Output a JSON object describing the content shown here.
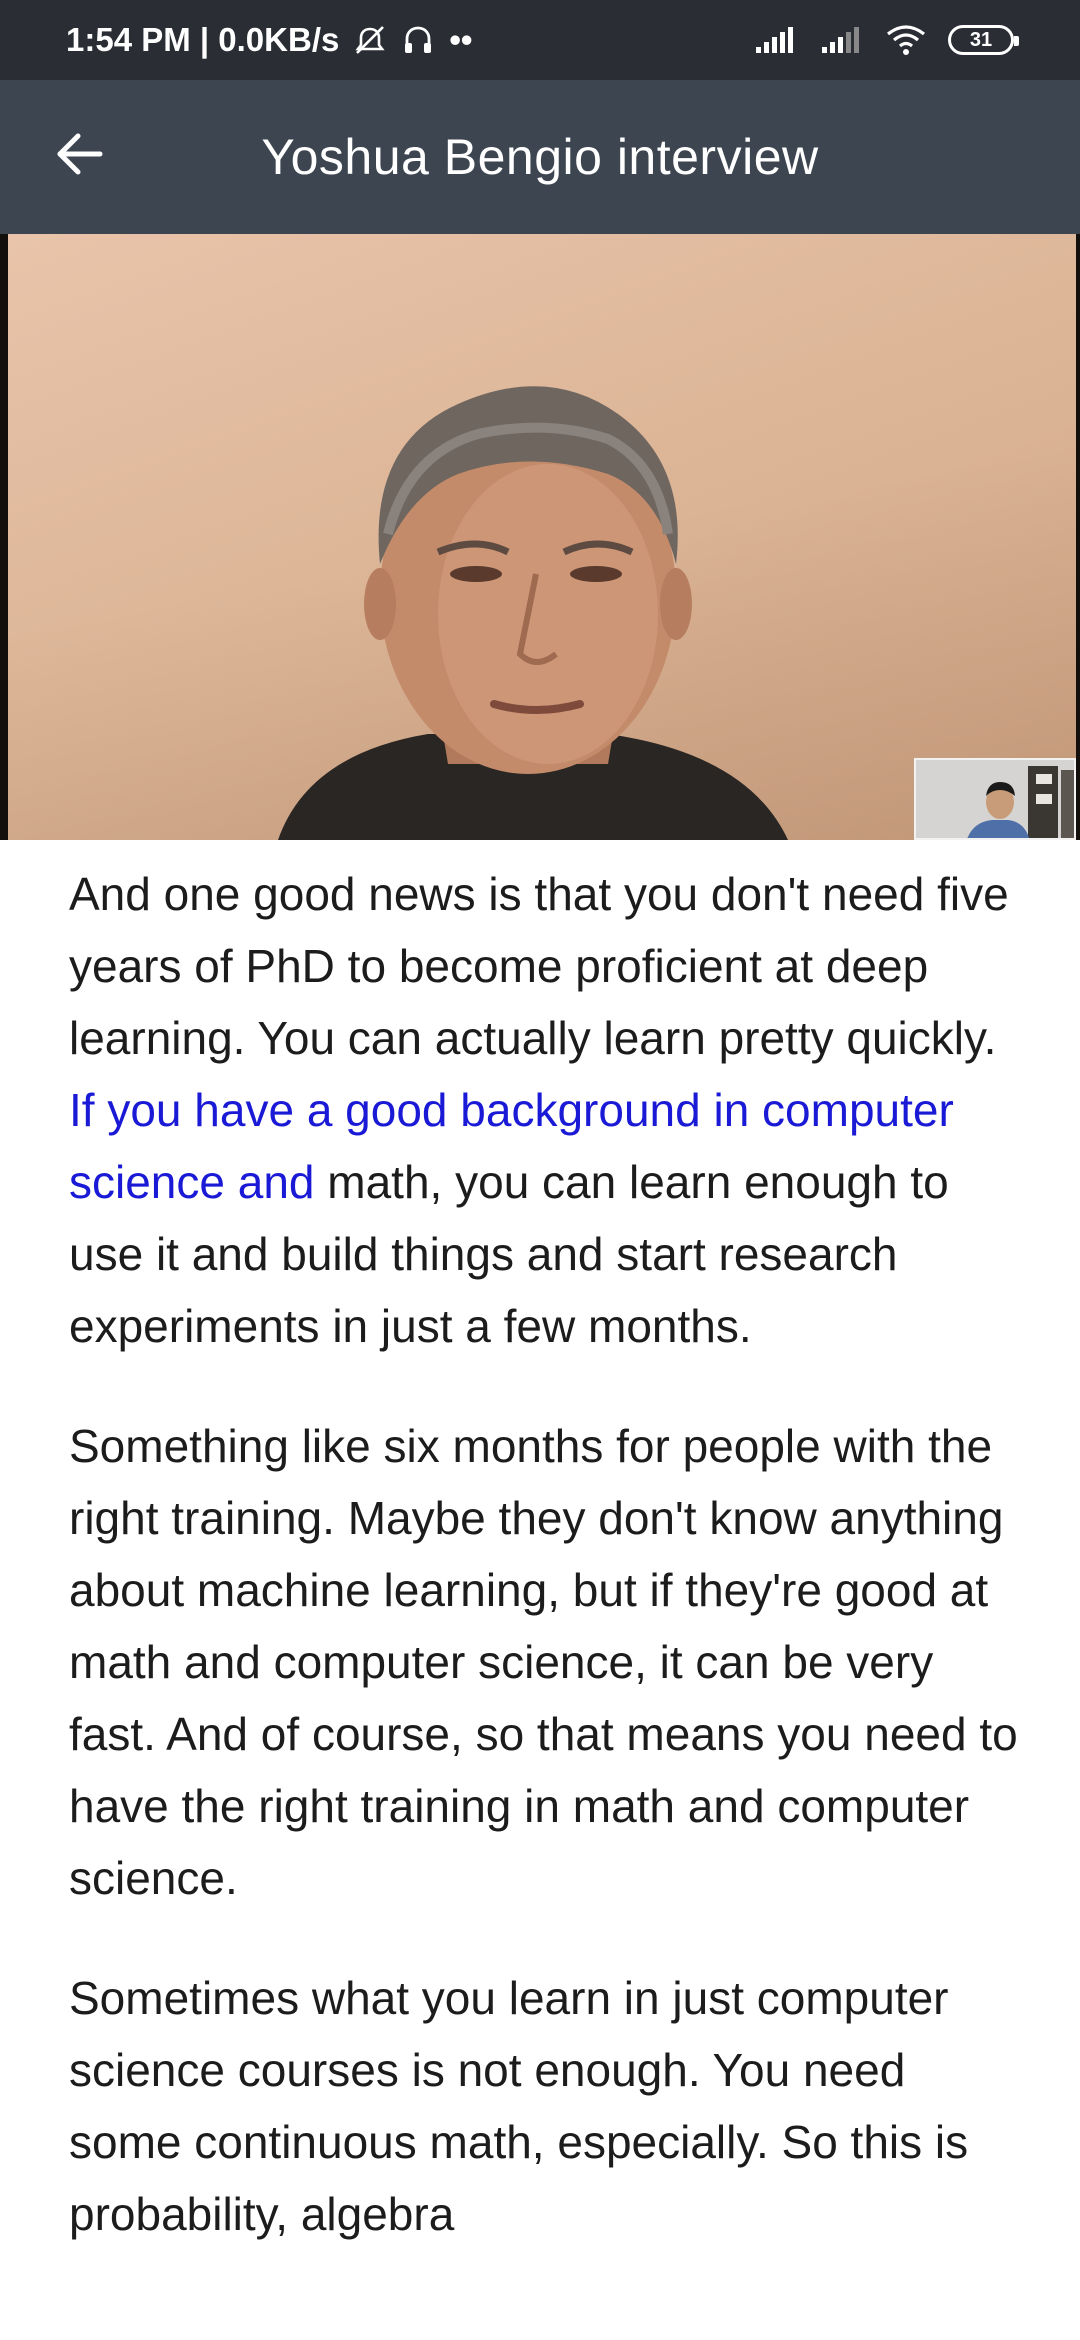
{
  "status_bar": {
    "time_and_speed": "1:54 PM | 0.0KB/s",
    "dots": "••",
    "battery_level": "31",
    "icons": [
      "alarm-off-icon",
      "headphones-icon",
      "signal-icon",
      "signal-icon",
      "wifi-icon",
      "battery-icon"
    ]
  },
  "app_bar": {
    "back_icon": "arrow-left-icon",
    "title": "Yoshua Bengio interview"
  },
  "video": {
    "main_speaker_icon": "video-feed",
    "pip_icon": "picture-in-picture-feed"
  },
  "transcript": {
    "paragraphs": [
      {
        "before": "And one good news is that you don't need five years of PhD to become proficient at deep learning. You can actually learn pretty quickly. ",
        "highlight": "If you have a good background in computer science and",
        "after": " math, you can learn enough to use it and build things and start research experiments in just a few months."
      },
      {
        "text": "Something like six months for people with the right training. Maybe they don't know anything about machine learning, but if they're good at math and computer science, it can be very fast. And of course, so that means you need to have the right training in math and computer science."
      },
      {
        "text": "Sometimes what you learn in just computer science courses is not enough. You need some continuous math, especially. So this is probability, algebra"
      }
    ]
  },
  "colors": {
    "status_bar_bg": "#2a2e34",
    "app_bar_bg": "#3d4550",
    "highlight": "#1a1ad6",
    "text": "#1c1c1c"
  }
}
